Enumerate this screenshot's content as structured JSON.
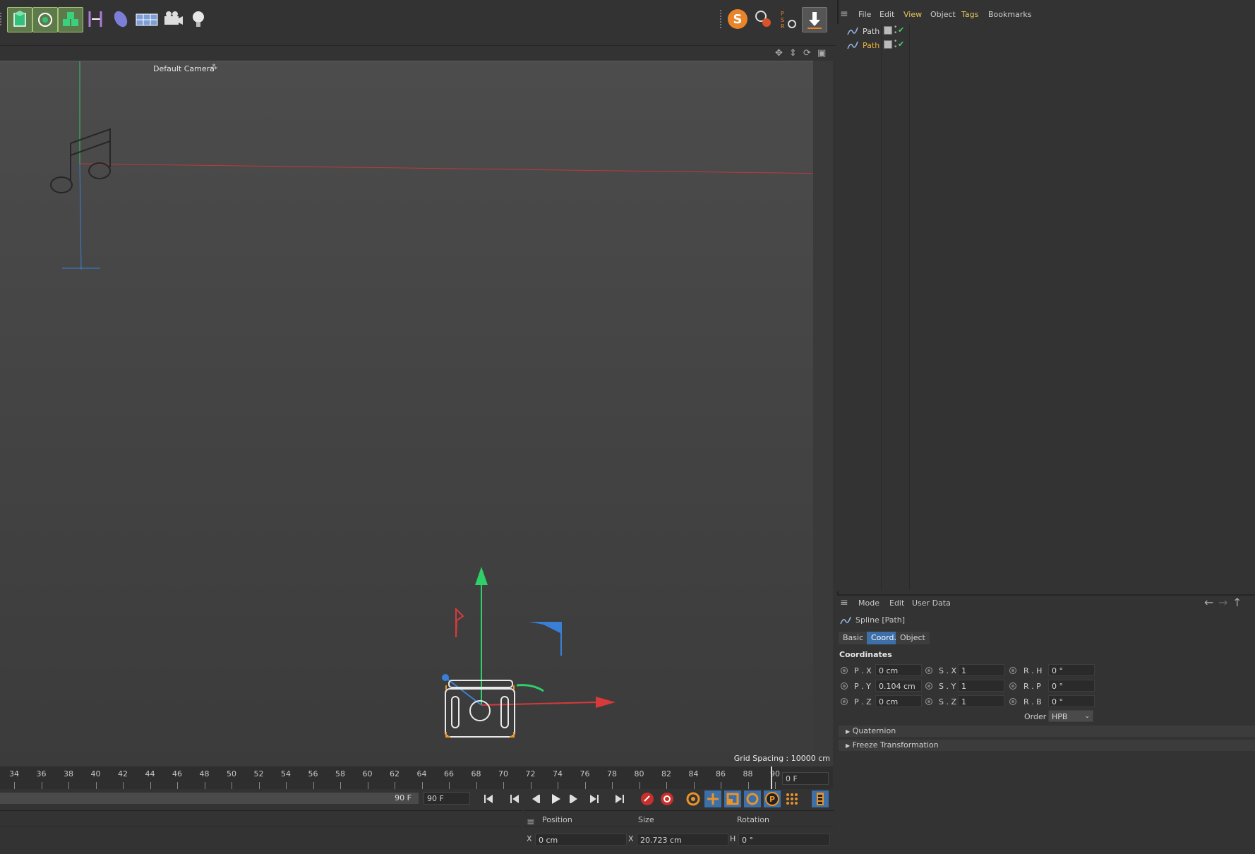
{
  "toolbar": {
    "left_icons": [
      "cube-icon",
      "cloner-icon",
      "array-icon",
      "deformer-icon",
      "extrude-icon",
      "floor-icon",
      "camera-icon",
      "light-icon"
    ],
    "right_icons": [
      "s-plugin-icon",
      "search-tool-icon",
      "psr-icon",
      "download-icon"
    ]
  },
  "viewport": {
    "camera_label": "Default Camera",
    "grid_spacing": "Grid Spacing : 10000 cm"
  },
  "timeline": {
    "ticks": [
      "34",
      "36",
      "38",
      "40",
      "42",
      "44",
      "46",
      "48",
      "50",
      "52",
      "54",
      "56",
      "58",
      "60",
      "62",
      "64",
      "66",
      "68",
      "70",
      "72",
      "74",
      "76",
      "78",
      "80",
      "82",
      "84",
      "86",
      "88",
      "90"
    ],
    "current_frame": "0 F",
    "range_end_label": "90 F",
    "end_frame": "90 F"
  },
  "coord_manager": {
    "headers": {
      "position": "Position",
      "size": "Size",
      "rotation": "Rotation"
    },
    "row_x": {
      "axis": "X",
      "position": "0 cm",
      "size_axis": "X",
      "size": "20.723 cm",
      "rot_axis": "H",
      "rotation": "0 °"
    }
  },
  "object_manager": {
    "menu": [
      "File",
      "Edit",
      "View",
      "Object",
      "Tags",
      "Bookmarks"
    ],
    "objects": [
      {
        "name": "Path",
        "selected": false
      },
      {
        "name": "Path",
        "selected": true
      }
    ]
  },
  "attributes": {
    "menu": [
      "Mode",
      "Edit",
      "User Data"
    ],
    "object_title": "Spline [Path]",
    "tabs": [
      {
        "label": "Basic",
        "active": false
      },
      {
        "label": "Coord.",
        "active": true
      },
      {
        "label": "Object",
        "active": false
      }
    ],
    "section_title": "Coordinates",
    "rows": [
      {
        "p_label": "P . X",
        "p_value": "0 cm",
        "s_label": "S . X",
        "s_value": "1",
        "r_label": "R . H",
        "r_value": "0 °"
      },
      {
        "p_label": "P . Y",
        "p_value": "0.104 cm",
        "s_label": "S . Y",
        "s_value": "1",
        "r_label": "R . P",
        "r_value": "0 °"
      },
      {
        "p_label": "P . Z",
        "p_value": "0 cm",
        "s_label": "S . Z",
        "s_value": "1",
        "r_label": "R . B",
        "r_value": "0 °"
      }
    ],
    "order_label": "Order",
    "order_value": "HPB",
    "collapsed_sections": [
      "Quaternion",
      "Freeze Transformation"
    ]
  },
  "colors": {
    "accent_blue": "#3d6fa8",
    "selected_text": "#e8b23a",
    "x_axis": "#d33",
    "y_axis": "#2fcf6a",
    "z_axis": "#3a7fd6"
  }
}
